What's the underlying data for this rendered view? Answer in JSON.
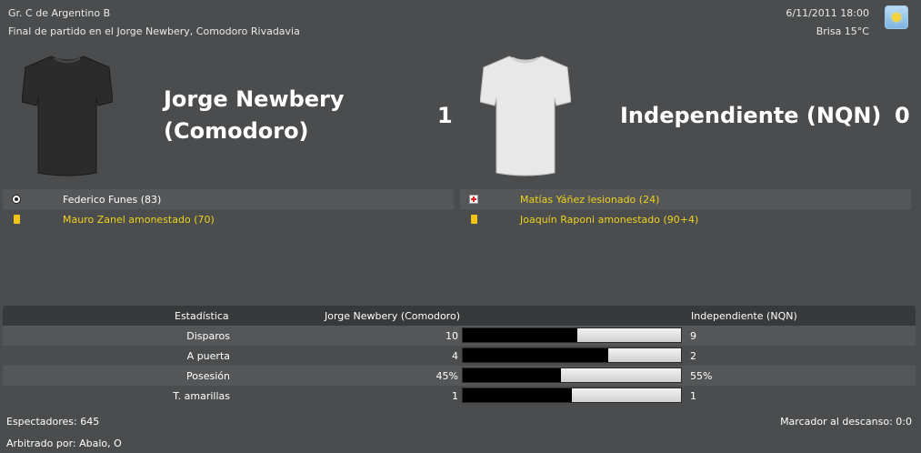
{
  "header": {
    "competition": "Gr. C de Argentino B",
    "status": "Final de partido en el Jorge Newbery, Comodoro Rivadavia",
    "datetime": "6/11/2011 18:00",
    "weather": "Brisa 15°C",
    "weather_icon": "sun-icon"
  },
  "home": {
    "name_line1": "Jorge Newbery",
    "name_line2": "(Comodoro)",
    "score": "1",
    "shirt_color": "#2b2b2b"
  },
  "away": {
    "name": "Independiente (NQN)",
    "score": "0",
    "shirt_color": "#e8e8e8"
  },
  "home_events": [
    {
      "icon": "ball-icon",
      "text": "Federico Funes (83)"
    },
    {
      "icon": "yellow-card-icon",
      "text": "Mauro Zanel amonestado (70)"
    }
  ],
  "away_events": [
    {
      "icon": "injury-icon",
      "text": "Matías Yáñez lesionado (24)"
    },
    {
      "icon": "yellow-card-icon",
      "text": "Joaquín Raponi amonestado (90+4)"
    }
  ],
  "stats": {
    "header_label": "Estadística",
    "home_label": "Jorge Newbery (Comodoro)",
    "away_label": "Independiente (NQN)",
    "rows": [
      {
        "label": "Disparos",
        "home": "10",
        "away": "9",
        "home_share": 0.526
      },
      {
        "label": "A puerta",
        "home": "4",
        "away": "2",
        "home_share": 0.667
      },
      {
        "label": "Posesión",
        "home": "45%",
        "away": "55%",
        "home_share": 0.45
      },
      {
        "label": "T. amarillas",
        "home": "1",
        "away": "1",
        "home_share": 0.5
      }
    ]
  },
  "footer": {
    "spectators": "Espectadores: 645",
    "referee": "Arbitrado por: Abalo, O",
    "halftime": "Marcador al descanso: 0:0"
  }
}
